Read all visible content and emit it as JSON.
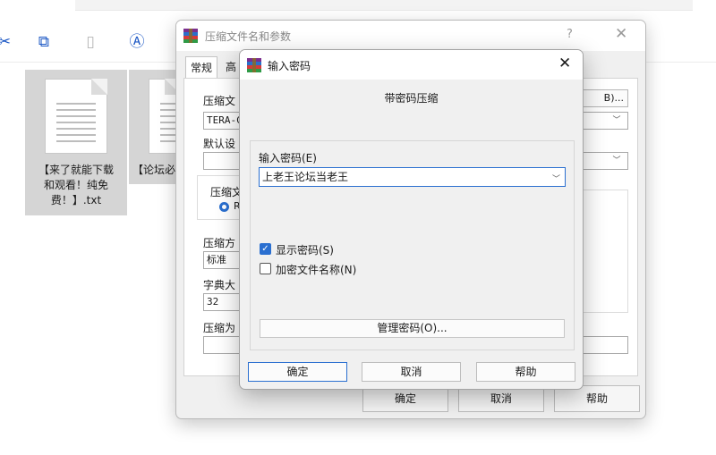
{
  "explorer": {
    "files": [
      {
        "name_line1": "【来了就能下载",
        "name_line2": "和观看！纯免",
        "name_line3": "费！】.txt"
      },
      {
        "name_line1": "【论坛必"
      }
    ],
    "toolbar_icons": [
      "copy-icon",
      "paste-icon",
      "rename-icon"
    ]
  },
  "outer_dialog": {
    "title": "压缩文件名和参数",
    "help_glyph": "?",
    "close_glyph": "✕",
    "tabs": [
      {
        "label": "常规"
      },
      {
        "label": "高"
      }
    ],
    "archive_name_label": "压缩文",
    "browse_button": "B)...",
    "archive_name_value": "TERA-C",
    "profile_label": "默认设",
    "format_label": "压缩文",
    "format_option": "R",
    "method_label": "压缩方",
    "method_value": "标准",
    "dict_label": "字典大",
    "dict_value": "32",
    "split_label": "压缩为",
    "ok_button": "确定",
    "cancel_button": "取消",
    "help_button": "帮助"
  },
  "inner_dialog": {
    "title": "输入密码",
    "close_glyph": "✕",
    "heading": "带密码压缩",
    "password_label": "输入密码(E)",
    "password_value": "上老王论坛当老王",
    "show_password_label": "显示密码(S)",
    "show_password_checked": true,
    "encrypt_names_label": "加密文件名称(N)",
    "encrypt_names_checked": false,
    "manage_button": "管理密码(O)...",
    "ok_button": "确定",
    "cancel_button": "取消",
    "help_button": "帮助"
  },
  "colors": {
    "accent": "#2a6fd0",
    "selection": "#d5d5d5",
    "dialog_bg": "#f0f0f0"
  }
}
